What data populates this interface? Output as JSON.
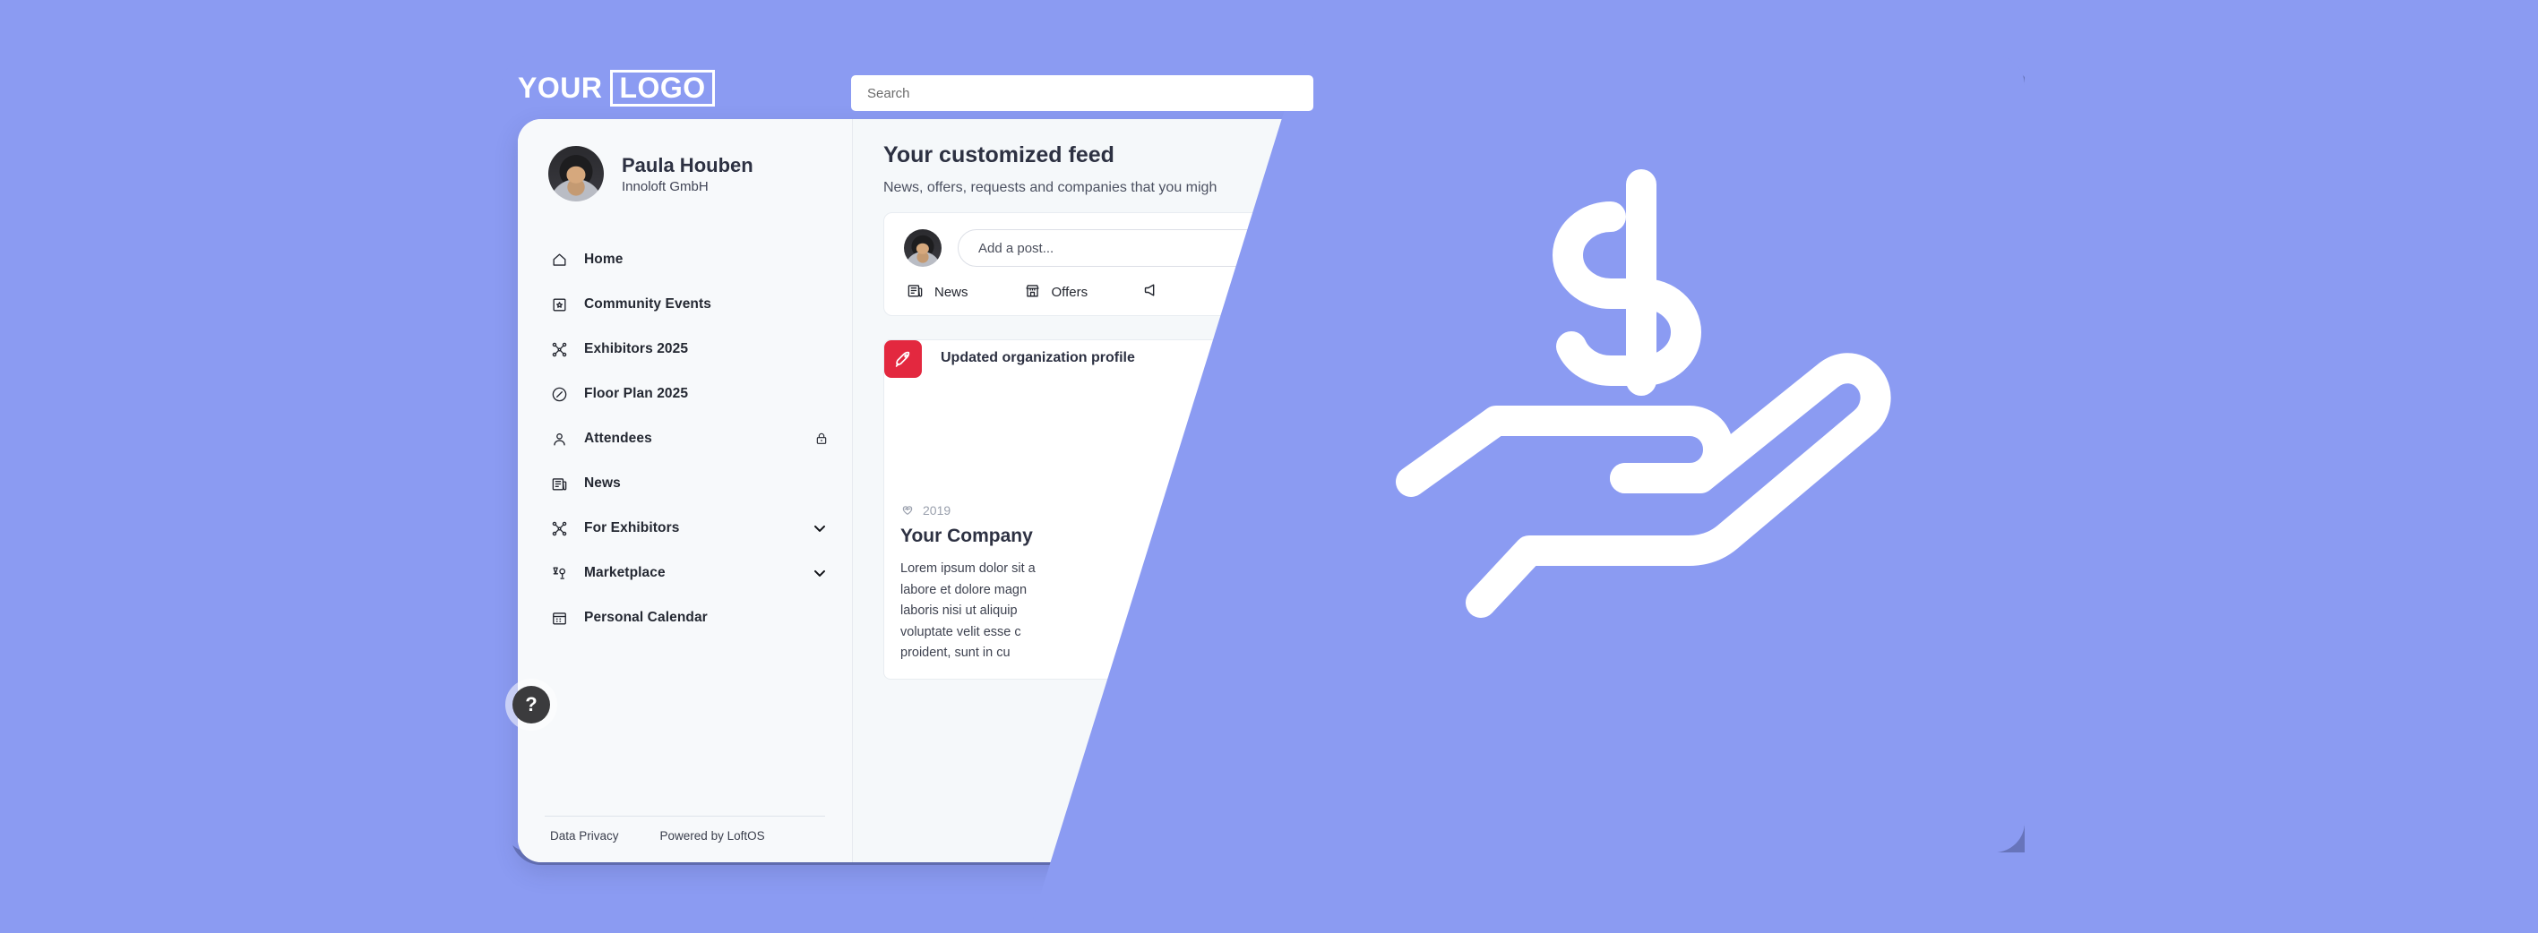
{
  "brand": {
    "logo_word_1": "YOUR",
    "logo_word_2": "LOGO",
    "accent_purple": "#8b9bf2",
    "accent_red": "#e3283f",
    "window_bg": "#ffffff",
    "sidebar_bg": "#f7f9fb",
    "feed_bg": "#f5f8fa"
  },
  "search": {
    "placeholder": "Search",
    "icon": "search-icon"
  },
  "profile": {
    "name": "Paula Houben",
    "organization": "Innoloft GmbH",
    "avatar_icon": "user-avatar"
  },
  "sidebar": {
    "items": [
      {
        "label": "Home",
        "icon": "home-icon",
        "lock": false,
        "chevron": false
      },
      {
        "label": "Community Events",
        "icon": "calendar-star-icon",
        "lock": false,
        "chevron": false
      },
      {
        "label": "Exhibitors 2025",
        "icon": "network-icon",
        "lock": false,
        "chevron": false
      },
      {
        "label": "Floor Plan 2025",
        "icon": "compass-icon",
        "lock": false,
        "chevron": false
      },
      {
        "label": "Attendees",
        "icon": "user-icon",
        "lock": true,
        "chevron": false
      },
      {
        "label": "News",
        "icon": "newspaper-icon",
        "lock": false,
        "chevron": false
      },
      {
        "label": "For Exhibitors",
        "icon": "network-icon",
        "lock": false,
        "chevron": true
      },
      {
        "label": "Marketplace",
        "icon": "marketplace-icon",
        "lock": false,
        "chevron": true
      },
      {
        "label": "Personal Calendar",
        "icon": "calendar-icon",
        "lock": false,
        "chevron": false
      }
    ],
    "help_button": "?",
    "footer_links": [
      "Data Privacy",
      "Powered by LoftOS"
    ]
  },
  "feed": {
    "title": "Your customized feed",
    "subtitle": "News, offers, requests and companies that you migh",
    "composer": {
      "placeholder": "Add a post...",
      "tabs": [
        {
          "label": "News",
          "icon": "newspaper-icon"
        },
        {
          "label": "Offers",
          "icon": "storefront-icon"
        },
        {
          "label": "",
          "icon": "megaphone-icon"
        }
      ]
    },
    "post": {
      "badge_icon": "rocket-icon",
      "title": "Updated organization profile",
      "company": {
        "year": "2019",
        "year_icon": "heart-pulse-icon",
        "name": "Your Company",
        "description": "Lorem ipsum dolor sit a\nlabore et dolore magn\nlaboris nisi ut aliquip\nvoluptate velit esse c\nproident, sunt in cu"
      }
    }
  },
  "illustration": {
    "name": "hand-holding-dollar-icon",
    "color": "#ffffff"
  }
}
